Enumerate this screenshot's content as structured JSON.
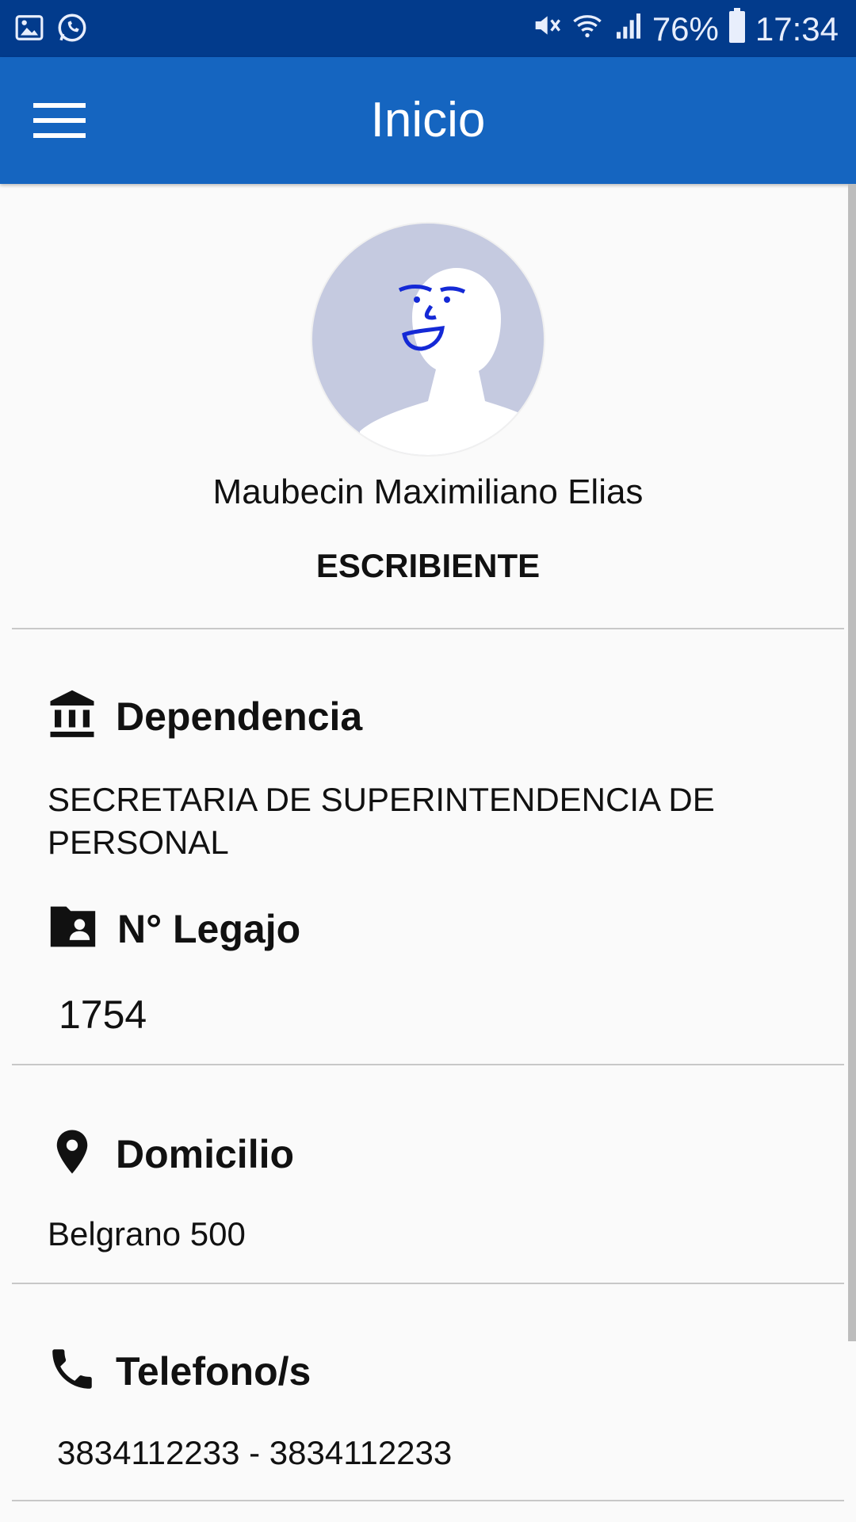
{
  "status_bar": {
    "battery": "76%",
    "time": "17:34",
    "icons": [
      "image-icon",
      "whatsapp-icon",
      "mute-icon",
      "wifi-icon",
      "signal-icon",
      "battery-icon"
    ]
  },
  "app_bar": {
    "title": "Inicio",
    "menu_icon": "hamburger-menu-icon"
  },
  "profile": {
    "name": "Maubecin Maximiliano Elias",
    "role": "ESCRIBIENTE"
  },
  "sections": {
    "dependencia": {
      "icon": "bank-icon",
      "label": "Dependencia",
      "value": "SECRETARIA DE SUPERINTENDENCIA DE PERSONAL"
    },
    "legajo": {
      "icon": "folder-account-icon",
      "label": "N° Legajo",
      "value": "1754"
    },
    "domicilio": {
      "icon": "map-marker-icon",
      "label": "Domicilio",
      "value": "Belgrano 500"
    },
    "telefono": {
      "icon": "phone-icon",
      "label": "Telefono/s",
      "value": "3834112233 - 3834112233"
    }
  },
  "colors": {
    "status_bar": "#023b8c",
    "app_bar": "#1565c0",
    "background": "#fafafa",
    "avatar_bg": "#c5cae0"
  }
}
